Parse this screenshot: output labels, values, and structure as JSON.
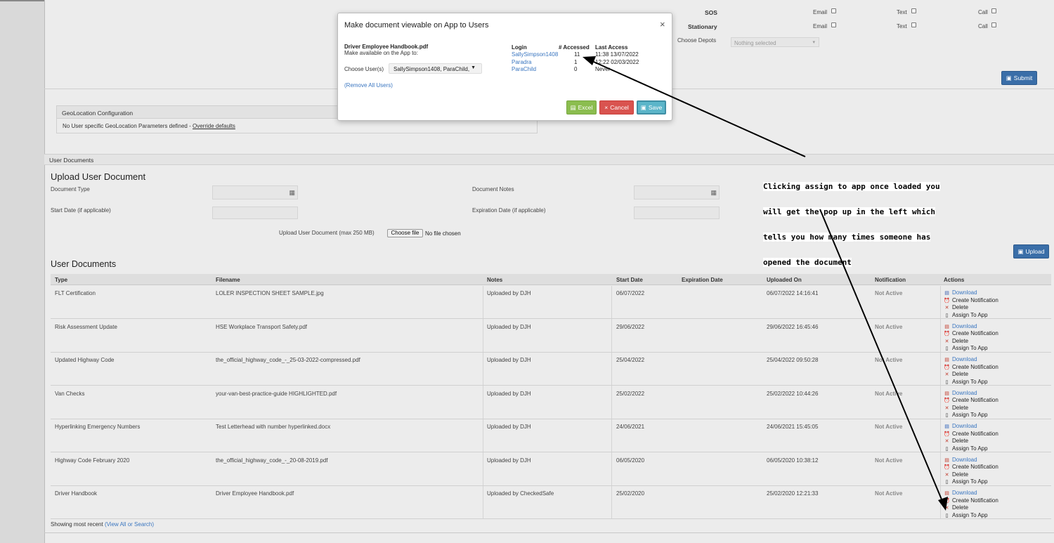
{
  "top_right_panel": {
    "sos_label": "SOS",
    "stationary_label": "Stationary",
    "email_label": "Email",
    "text_label": "Text",
    "call_label": "Call",
    "choose_depots_label": "Choose Depots",
    "depots_placeholder": "Nothing selected",
    "submit_label": "Submit"
  },
  "geolocation": {
    "title": "GeoLocation Configuration",
    "message": "No User specific GeoLocation Parameters defined -",
    "override_link": "Override defaults"
  },
  "user_documents_section": {
    "section_label": "User Documents",
    "upload_title": "Upload User Document",
    "document_type_label": "Document Type",
    "document_notes_label": "Document Notes",
    "start_date_label": "Start Date (if applicable)",
    "expiration_date_label": "Expiration Date (if applicable)",
    "upload_file_label": "Upload User Document (max 250 MB)",
    "choose_file_label": "Choose file",
    "no_file_label": "No file chosen",
    "upload_button": "Upload",
    "list_title": "User Documents",
    "footer_text": "Showing most recent",
    "footer_link": "(View All or Search)"
  },
  "table": {
    "headers": [
      "Type",
      "Filename",
      "Notes",
      "Start Date",
      "Expiration Date",
      "Uploaded On",
      "Notification",
      "Actions"
    ],
    "actions": [
      "Download",
      "Create Notification",
      "Delete",
      "Assign To App"
    ],
    "rows": [
      {
        "type": "FLT Certification",
        "filename": "LOLER INSPECTION SHEET SAMPLE.jpg",
        "notes": "Uploaded by DJH",
        "start": "06/07/2022",
        "expiration": "",
        "uploaded": "06/07/2022 14:16:41",
        "notification": "Not Active",
        "file_icon_color": "#3a60b0"
      },
      {
        "type": "Risk Assessment Update",
        "filename": "HSE Workplace Transport Safety.pdf",
        "notes": "Uploaded by DJH",
        "start": "29/06/2022",
        "expiration": "",
        "uploaded": "29/06/2022 16:45:46",
        "notification": "Not Active",
        "file_icon_color": "#c0392b"
      },
      {
        "type": "Updated Highway Code",
        "filename": "the_official_highway_code_-_25-03-2022-compressed.pdf",
        "notes": "Uploaded by DJH",
        "start": "25/04/2022",
        "expiration": "",
        "uploaded": "25/04/2022 09:50:28",
        "notification": "Not Active",
        "file_icon_color": "#c0392b"
      },
      {
        "type": "Van Checks",
        "filename": "your-van-best-practice-guide HIGHLIGHTED.pdf",
        "notes": "Uploaded by DJH",
        "start": "25/02/2022",
        "expiration": "",
        "uploaded": "25/02/2022 10:44:26",
        "notification": "Not Active",
        "file_icon_color": "#c0392b"
      },
      {
        "type": "Hyperlinking Emergency Numbers",
        "filename": "Test Letterhead with number hyperlinked.docx",
        "notes": "Uploaded by DJH",
        "start": "24/06/2021",
        "expiration": "",
        "uploaded": "24/06/2021 15:45:05",
        "notification": "Not Active",
        "file_icon_color": "#2a5fb8"
      },
      {
        "type": "Highway Code February 2020",
        "filename": "the_official_highway_code_-_20-08-2019.pdf",
        "notes": "Uploaded by DJH",
        "start": "06/05/2020",
        "expiration": "",
        "uploaded": "06/05/2020 10:38:12",
        "notification": "Not Active",
        "file_icon_color": "#c0392b"
      },
      {
        "type": "Driver Handbook",
        "filename": "Driver Employee Handbook.pdf",
        "notes": "Uploaded by CheckedSafe",
        "start": "25/02/2020",
        "expiration": "",
        "uploaded": "25/02/2020 12:21:33",
        "notification": "Not Active",
        "file_icon_color": "#c0392b"
      }
    ]
  },
  "modal": {
    "title": "Make document viewable on App to Users",
    "filename": "Driver Employee Handbook.pdf",
    "subtitle": "Make available on the App to:",
    "choose_users_label": "Choose User(s)",
    "selected_users": "SallySimpson1408, ParaChild,",
    "remove_all_link": "(Remove All Users)",
    "columns": {
      "login": "Login",
      "accessed": "# Accessed",
      "last_access": "Last Access"
    },
    "access_rows": [
      {
        "login": "SallySimpson1408",
        "accessed": "11",
        "last_access": "11:38 13/07/2022"
      },
      {
        "login": "Paradra",
        "accessed": "1",
        "last_access": "12:22 02/03/2022"
      },
      {
        "login": "ParaChild",
        "accessed": "0",
        "last_access": "Never"
      }
    ],
    "excel_label": "Excel",
    "cancel_label": "Cancel",
    "save_label": "Save",
    "close_symbol": "×"
  },
  "annotation": {
    "lines": [
      "Clicking assign to app once loaded you",
      "will get the pop up in the left which",
      "tells you how many times someone has",
      "opened the document"
    ]
  },
  "colors": {
    "accent_blue": "#3a6ea8",
    "link_blue": "#3a76c0",
    "excel_green": "#8bbd4f",
    "cancel_red": "#d9534f",
    "save_teal": "#5bb5c9"
  }
}
